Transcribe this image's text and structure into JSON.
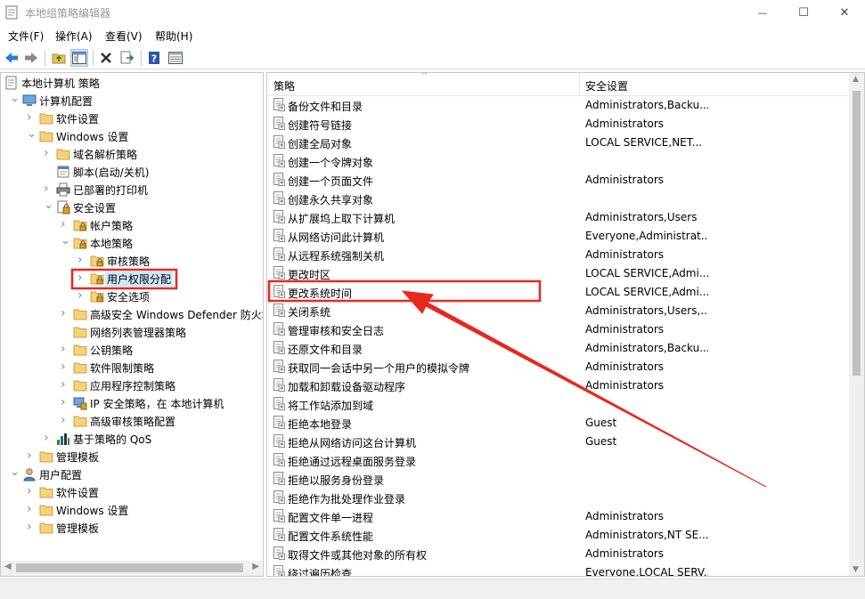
{
  "window": {
    "title": "本地组策略编辑器",
    "minimize": "—",
    "maximize": "☐",
    "close": "✕"
  },
  "menu": [
    "文件(F)",
    "操作(A)",
    "查看(V)",
    "帮助(H)"
  ],
  "toolbar": {
    "icons": [
      "back-icon",
      "forward-icon",
      "up-folder-icon",
      "show-hide-tree-icon",
      "delete-icon",
      "export-list-icon",
      "help-icon",
      "properties-view-icon"
    ]
  },
  "tree": {
    "nodes": [
      {
        "label": "本地计算机 策略",
        "depth": 0,
        "arrow": "",
        "icon": "policy"
      },
      {
        "label": "计算机配置",
        "depth": 1,
        "arrow": "open",
        "icon": "computer"
      },
      {
        "label": "软件设置",
        "depth": 2,
        "arrow": "closed",
        "icon": "folder"
      },
      {
        "label": "Windows 设置",
        "depth": 2,
        "arrow": "open",
        "icon": "folder"
      },
      {
        "label": "域名解析策略",
        "depth": 3,
        "arrow": "closed",
        "icon": "folder"
      },
      {
        "label": "脚本(启动/关机)",
        "depth": 3,
        "arrow": "",
        "icon": "script"
      },
      {
        "label": "已部署的打印机",
        "depth": 3,
        "arrow": "closed",
        "icon": "printer"
      },
      {
        "label": "安全设置",
        "depth": 3,
        "arrow": "open",
        "icon": "security"
      },
      {
        "label": "帐户策略",
        "depth": 4,
        "arrow": "closed",
        "icon": "lockfolder"
      },
      {
        "label": "本地策略",
        "depth": 4,
        "arrow": "open",
        "icon": "lockfolder"
      },
      {
        "label": "审核策略",
        "depth": 5,
        "arrow": "closed",
        "icon": "lockfolder"
      },
      {
        "label": "用户权限分配",
        "depth": 5,
        "arrow": "closed",
        "icon": "lockfolder",
        "selected": true
      },
      {
        "label": "安全选项",
        "depth": 5,
        "arrow": "closed",
        "icon": "lockfolder"
      },
      {
        "label": "高级安全 Windows Defender 防火墙",
        "depth": 4,
        "arrow": "closed",
        "icon": "folder"
      },
      {
        "label": "网络列表管理器策略",
        "depth": 4,
        "arrow": "",
        "icon": "folder"
      },
      {
        "label": "公钥策略",
        "depth": 4,
        "arrow": "closed",
        "icon": "folder"
      },
      {
        "label": "软件限制策略",
        "depth": 4,
        "arrow": "closed",
        "icon": "folder"
      },
      {
        "label": "应用程序控制策略",
        "depth": 4,
        "arrow": "closed",
        "icon": "folder"
      },
      {
        "label": "IP 安全策略，在 本地计算机",
        "depth": 4,
        "arrow": "closed",
        "icon": "ipsec"
      },
      {
        "label": "高级审核策略配置",
        "depth": 4,
        "arrow": "closed",
        "icon": "folder"
      },
      {
        "label": "基于策略的 QoS",
        "depth": 3,
        "arrow": "closed",
        "icon": "chart"
      },
      {
        "label": "管理模板",
        "depth": 2,
        "arrow": "closed",
        "icon": "folder"
      },
      {
        "label": "用户配置",
        "depth": 1,
        "arrow": "open",
        "icon": "user"
      },
      {
        "label": "软件设置",
        "depth": 2,
        "arrow": "closed",
        "icon": "folder"
      },
      {
        "label": "Windows 设置",
        "depth": 2,
        "arrow": "closed",
        "icon": "folder"
      },
      {
        "label": "管理模板",
        "depth": 2,
        "arrow": "closed",
        "icon": "folder"
      }
    ]
  },
  "list": {
    "col_policy": "策略",
    "col_setting": "安全设置",
    "highlight_index": 10,
    "rows": [
      {
        "policy": "备份文件和目录",
        "setting": "Administrators,Backu..."
      },
      {
        "policy": "创建符号链接",
        "setting": "Administrators"
      },
      {
        "policy": "创建全局对象",
        "setting": "LOCAL SERVICE,NET..."
      },
      {
        "policy": "创建一个令牌对象",
        "setting": ""
      },
      {
        "policy": "创建一个页面文件",
        "setting": "Administrators"
      },
      {
        "policy": "创建永久共享对象",
        "setting": ""
      },
      {
        "policy": "从扩展坞上取下计算机",
        "setting": "Administrators,Users"
      },
      {
        "policy": "从网络访问此计算机",
        "setting": "Everyone,Administrat..."
      },
      {
        "policy": "从远程系统强制关机",
        "setting": "Administrators"
      },
      {
        "policy": "更改时区",
        "setting": "LOCAL SERVICE,Admi..."
      },
      {
        "policy": "更改系统时间",
        "setting": "LOCAL SERVICE,Admi..."
      },
      {
        "policy": "关闭系统",
        "setting": "Administrators,Users,..."
      },
      {
        "policy": "管理审核和安全日志",
        "setting": "Administrators"
      },
      {
        "policy": "还原文件和目录",
        "setting": "Administrators,Backu..."
      },
      {
        "policy": "获取同一会话中另一个用户的模拟令牌",
        "setting": "Administrators"
      },
      {
        "policy": "加载和卸载设备驱动程序",
        "setting": "Administrators"
      },
      {
        "policy": "将工作站添加到域",
        "setting": ""
      },
      {
        "policy": "拒绝本地登录",
        "setting": "Guest"
      },
      {
        "policy": "拒绝从网络访问这台计算机",
        "setting": "Guest"
      },
      {
        "policy": "拒绝通过远程桌面服务登录",
        "setting": ""
      },
      {
        "policy": "拒绝以服务身份登录",
        "setting": ""
      },
      {
        "policy": "拒绝作为批处理作业登录",
        "setting": ""
      },
      {
        "policy": "配置文件单一进程",
        "setting": "Administrators"
      },
      {
        "policy": "配置文件系统性能",
        "setting": "Administrators,NT SE..."
      },
      {
        "policy": "取得文件或其他对象的所有权",
        "setting": "Administrators"
      },
      {
        "policy": "绕过遍历检查",
        "setting": "Everyone,LOCAL SERV..."
      }
    ]
  },
  "annotation": {
    "color": "#e8281e"
  }
}
